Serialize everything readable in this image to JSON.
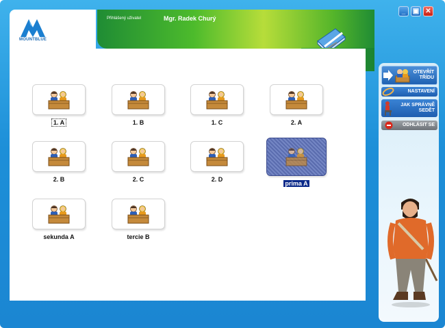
{
  "window": {
    "minimize": "_",
    "maximize": "▣",
    "close": "✕"
  },
  "logo": {
    "text": "MOUNTBLUE"
  },
  "header": {
    "user_label": "Přihlášený uživatel",
    "user_name": "Mgr. Radek Churý"
  },
  "classes": [
    {
      "name": "1. A",
      "state": "focused"
    },
    {
      "name": "1. B",
      "state": "normal"
    },
    {
      "name": "1. C",
      "state": "normal"
    },
    {
      "name": "2. A",
      "state": "normal"
    },
    {
      "name": "2. B",
      "state": "normal"
    },
    {
      "name": "2. C",
      "state": "normal"
    },
    {
      "name": "2. D",
      "state": "normal"
    },
    {
      "name": "prima A",
      "state": "selected"
    },
    {
      "name": "sekunda A",
      "state": "normal"
    },
    {
      "name": "tercie B",
      "state": "normal"
    }
  ],
  "sidebar": {
    "open": "OTEVŘÍT TŘÍDU",
    "open_l1": "OTEVŘÍT",
    "open_l2": "TŘÍDU",
    "settings": "NASTAVENÍ",
    "seat": "JAK SPRÁVNĚ SEDĚT",
    "seat_l1": "JAK SPRÁVNĚ",
    "seat_l2": "SEDĚT",
    "logout": "ODHLÁSIT SE"
  },
  "icons": {
    "class_tile": "classroom-desk-icon",
    "open": "arrow-classroom-icon",
    "settings": "key-icon",
    "seat": "person-chair-icon",
    "logout": "stop-icon"
  },
  "colors": {
    "frame_blue": "#1d8fd8",
    "header_green": "#4dbb2c",
    "selected": "#0b2a8a",
    "close_red": "#c81f12"
  }
}
